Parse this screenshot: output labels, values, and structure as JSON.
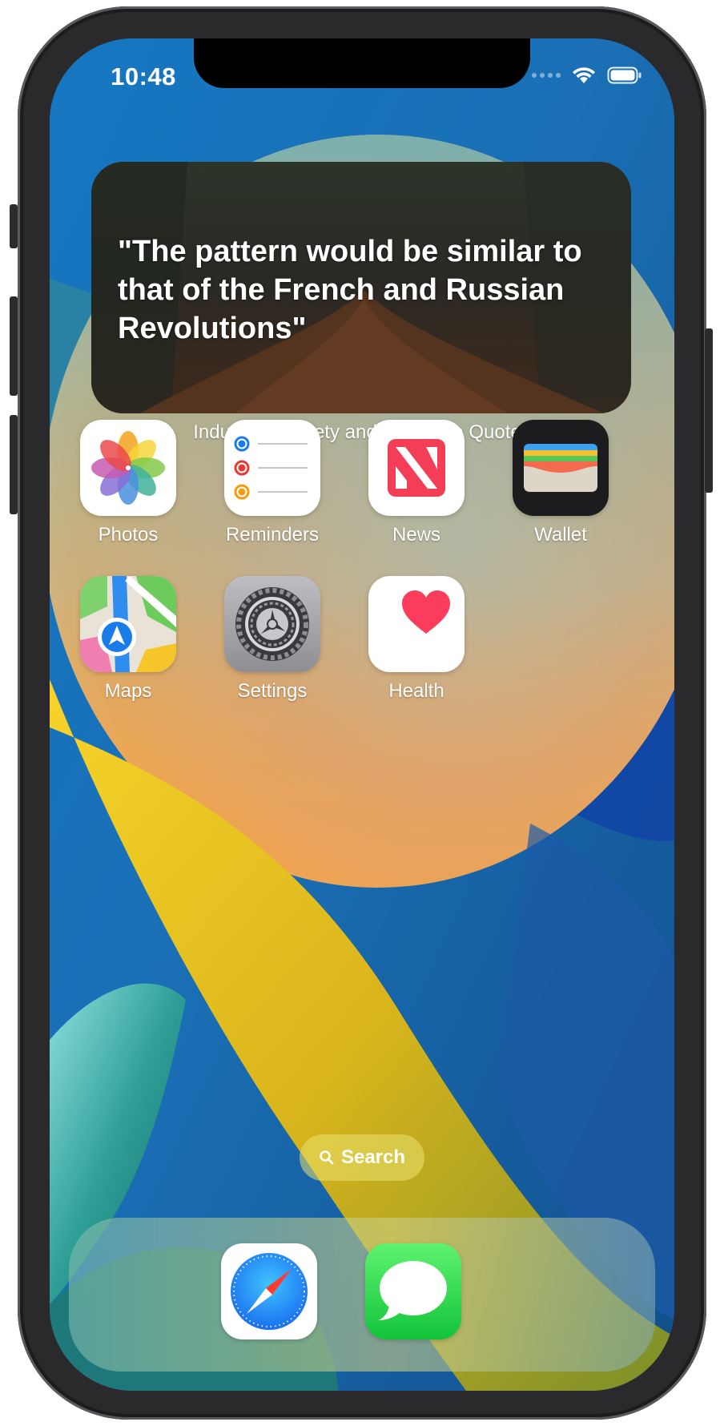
{
  "status_bar": {
    "time": "10:48",
    "icons": [
      "cellular-dots-icon",
      "wifi-icon",
      "battery-icon"
    ]
  },
  "widget": {
    "quote": "\"The pattern would be similar to that of the French and Russian Revolutions\"",
    "caption": "Industrial Society and Its Future Quotes"
  },
  "apps": [
    {
      "label": "Photos",
      "icon": "photos-icon"
    },
    {
      "label": "Reminders",
      "icon": "reminders-icon"
    },
    {
      "label": "News",
      "icon": "news-icon"
    },
    {
      "label": "Wallet",
      "icon": "wallet-icon"
    },
    {
      "label": "Maps",
      "icon": "maps-icon"
    },
    {
      "label": "Settings",
      "icon": "settings-icon"
    },
    {
      "label": "Health",
      "icon": "health-icon"
    }
  ],
  "search": {
    "label": "Search"
  },
  "dock": [
    {
      "icon": "safari-icon"
    },
    {
      "icon": "messages-icon"
    }
  ],
  "colors": {
    "wallpaper_blue": "#1b6fb0",
    "wallpaper_orange": "#f0a04a",
    "wallpaper_yellow": "#f4c820",
    "wallpaper_teal": "#2a8a8a"
  }
}
